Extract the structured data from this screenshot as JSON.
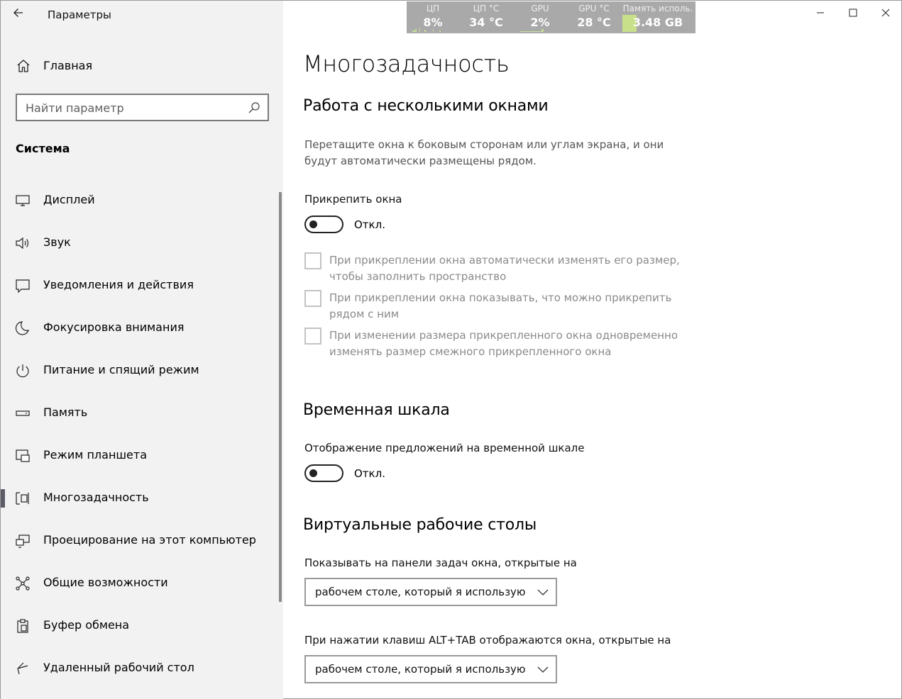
{
  "window": {
    "title": "Параметры"
  },
  "sidebar": {
    "home_label": "Главная",
    "search_placeholder": "Найти параметр",
    "group_title": "Система",
    "items": [
      {
        "label": "Дисплей",
        "icon": "display-icon"
      },
      {
        "label": "Звук",
        "icon": "speaker-icon"
      },
      {
        "label": "Уведомления и действия",
        "icon": "notification-icon"
      },
      {
        "label": "Фокусировка внимания",
        "icon": "moon-icon"
      },
      {
        "label": "Питание и спящий режим",
        "icon": "power-icon"
      },
      {
        "label": "Память",
        "icon": "storage-icon"
      },
      {
        "label": "Режим планшета",
        "icon": "tablet-mode-icon"
      },
      {
        "label": "Многозадачность",
        "icon": "multitasking-icon",
        "active": true
      },
      {
        "label": "Проецирование на этот компьютер",
        "icon": "projecting-icon"
      },
      {
        "label": "Общие возможности",
        "icon": "shared-experiences-icon"
      },
      {
        "label": "Буфер обмена",
        "icon": "clipboard-icon"
      },
      {
        "label": "Удаленный рабочий стол",
        "icon": "remote-desktop-icon"
      }
    ]
  },
  "perf": {
    "cpu": {
      "caption": "ЦП",
      "value": "8%"
    },
    "cpu_temp": {
      "caption": "ЦП °C",
      "value": "34 °C"
    },
    "gpu": {
      "caption": "GPU",
      "value": "2%"
    },
    "gpu_temp": {
      "caption": "GPU °C",
      "value": "28 °C"
    },
    "memory": {
      "caption": "Память исполь.",
      "value": "3.48 GB"
    }
  },
  "main": {
    "page_title": "Многозадачность",
    "snap": {
      "heading": "Работа с несколькими окнами",
      "description": "Перетащите окна к боковым сторонам или углам экрана, и они будут автоматически размещены рядом.",
      "toggle_label": "Прикрепить окна",
      "toggle_state": "Откл.",
      "checkboxes": [
        {
          "label": "При прикреплении окна автоматически изменять его размер, чтобы заполнить пространство",
          "checked": false
        },
        {
          "label": "При прикреплении окна показывать, что можно прикрепить рядом с ним",
          "checked": false
        },
        {
          "label": "При изменении размера прикрепленного окна одновременно изменять размер смежного прикрепленного окна",
          "checked": false
        }
      ]
    },
    "timeline": {
      "heading": "Временная шкала",
      "toggle_label": "Отображение предложений на временной шкале",
      "toggle_state": "Откл."
    },
    "virtual_desktops": {
      "heading": "Виртуальные рабочие столы",
      "taskbar_label": "Показывать на панели задач окна, открытые на",
      "taskbar_value": "рабочем столе, который я использую",
      "alttab_label": "При нажатии клавиш ALT+TAB отображаются окна, открытые на",
      "alttab_value": "рабочем столе, который я использую"
    }
  }
}
